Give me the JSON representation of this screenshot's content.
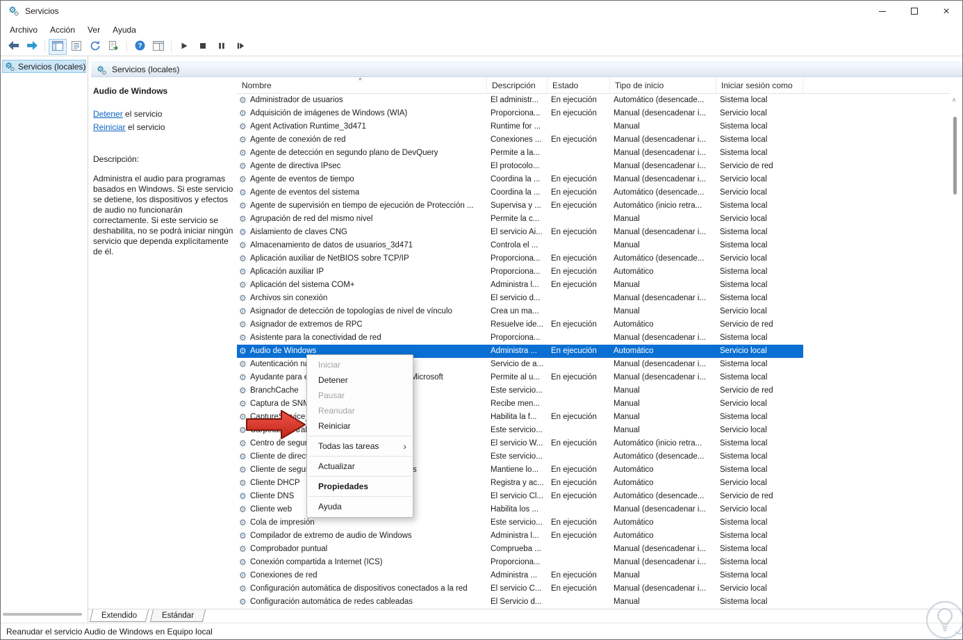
{
  "window": {
    "title": "Servicios"
  },
  "menubar": {
    "items": [
      "Archivo",
      "Acción",
      "Ver",
      "Ayuda"
    ]
  },
  "toolbar": {
    "groups": [
      [
        {
          "name": "back"
        },
        {
          "name": "forward"
        }
      ],
      [
        {
          "name": "show-console-tree",
          "pressed": true
        },
        {
          "name": "export-list"
        },
        {
          "name": "refresh"
        },
        {
          "name": "export"
        }
      ],
      [
        {
          "name": "help"
        },
        {
          "name": "window-pane"
        }
      ],
      [
        {
          "name": "start-service"
        },
        {
          "name": "stop-service"
        },
        {
          "name": "pause-service"
        },
        {
          "name": "restart-service"
        }
      ]
    ]
  },
  "tree": {
    "items": [
      {
        "label": "Servicios (locales)",
        "selected": true
      }
    ]
  },
  "main_header": {
    "title": "Servicios (locales)"
  },
  "info_pane": {
    "service_name": "Audio de Windows",
    "links": [
      {
        "action": "Detener",
        "suffix": " el servicio"
      },
      {
        "action": "Reiniciar",
        "suffix": " el servicio"
      }
    ],
    "description_label": "Descripción:",
    "description": "Administra el audio para programas basados en Windows. Si este servicio se detiene, los dispositivos y efectos de audio no funcionarán correctamente. Si este servicio se deshabilita, no se podrá iniciar ningún servicio que dependa explícitamente de él."
  },
  "table": {
    "columns": [
      "Nombre",
      "Descripción",
      "Estado",
      "Tipo de inicio",
      "Iniciar sesión como"
    ],
    "rows": [
      {
        "name": "Administrador de usuarios",
        "desc": "El administr...",
        "status": "En ejecución",
        "startup": "Automático (desencade...",
        "logon": "Sistema local"
      },
      {
        "name": "Adquisición de imágenes de Windows (WIA)",
        "desc": "Proporciona...",
        "status": "En ejecución",
        "startup": "Manual (desencadenar i...",
        "logon": "Servicio local"
      },
      {
        "name": "Agent Activation Runtime_3d471",
        "desc": "Runtime for ...",
        "status": "",
        "startup": "Manual",
        "logon": "Sistema local"
      },
      {
        "name": "Agente de conexión de red",
        "desc": "Conexiones ...",
        "status": "En ejecución",
        "startup": "Manual (desencadenar i...",
        "logon": "Sistema local"
      },
      {
        "name": "Agente de detección en segundo plano de DevQuery",
        "desc": "Permite a la...",
        "status": "",
        "startup": "Manual (desencadenar i...",
        "logon": "Sistema local"
      },
      {
        "name": "Agente de directiva IPsec",
        "desc": "El protocolo...",
        "status": "",
        "startup": "Manual (desencadenar i...",
        "logon": "Servicio de red"
      },
      {
        "name": "Agente de eventos de tiempo",
        "desc": "Coordina la ...",
        "status": "En ejecución",
        "startup": "Manual (desencadenar i...",
        "logon": "Servicio local"
      },
      {
        "name": "Agente de eventos del sistema",
        "desc": "Coordina la ...",
        "status": "En ejecución",
        "startup": "Automático (desencade...",
        "logon": "Servicio local"
      },
      {
        "name": "Agente de supervisión en tiempo de ejecución de Protección ...",
        "desc": "Supervisa y ...",
        "status": "En ejecución",
        "startup": "Automático (inicio retra...",
        "logon": "Sistema local"
      },
      {
        "name": "Agrupación de red del mismo nivel",
        "desc": "Permite la c...",
        "status": "",
        "startup": "Manual",
        "logon": "Servicio local"
      },
      {
        "name": "Aislamiento de claves CNG",
        "desc": "El servicio Ai...",
        "status": "En ejecución",
        "startup": "Manual (desencadenar i...",
        "logon": "Sistema local"
      },
      {
        "name": "Almacenamiento de datos de usuarios_3d471",
        "desc": "Controla el ...",
        "status": "",
        "startup": "Manual",
        "logon": "Sistema local"
      },
      {
        "name": "Aplicación auxiliar de NetBIOS sobre TCP/IP",
        "desc": "Proporciona...",
        "status": "En ejecución",
        "startup": "Automático (desencade...",
        "logon": "Servicio local"
      },
      {
        "name": "Aplicación auxiliar IP",
        "desc": "Proporciona...",
        "status": "En ejecución",
        "startup": "Automático",
        "logon": "Sistema local"
      },
      {
        "name": "Aplicación del sistema COM+",
        "desc": "Administra l...",
        "status": "En ejecución",
        "startup": "Manual",
        "logon": "Sistema local"
      },
      {
        "name": "Archivos sin conexión",
        "desc": "El servicio d...",
        "status": "",
        "startup": "Manual (desencadenar i...",
        "logon": "Sistema local"
      },
      {
        "name": "Asignador de detección de topologías de nivel de vínculo",
        "desc": "Crea un ma...",
        "status": "",
        "startup": "Manual",
        "logon": "Servicio local"
      },
      {
        "name": "Asignador de extremos de RPC",
        "desc": "Resuelve ide...",
        "status": "En ejecución",
        "startup": "Automático",
        "logon": "Servicio de red"
      },
      {
        "name": "Asistente para la conectividad de red",
        "desc": "Proporciona...",
        "status": "",
        "startup": "Manual (desencadenar i...",
        "logon": "Sistema local"
      },
      {
        "name": "Audio de Windows",
        "desc": "Administra ...",
        "status": "En ejecución",
        "startup": "Automático",
        "logon": "Servicio local",
        "selected": true
      },
      {
        "name": "Autenticación natural",
        "desc": "Servicio de a...",
        "status": "",
        "startup": "Manual (desencadenar i...",
        "logon": "Sistema local"
      },
      {
        "name": "Ayudante para el inicio de sesión de cuentas Microsoft",
        "desc": "Permite al u...",
        "status": "En ejecución",
        "startup": "Manual (desencadenar i...",
        "logon": "Sistema local"
      },
      {
        "name": "BranchCache",
        "desc": "Este servicio...",
        "status": "",
        "startup": "Manual",
        "logon": "Servicio de red"
      },
      {
        "name": "Captura de SNMP",
        "desc": "Recibe men...",
        "status": "",
        "startup": "Manual",
        "logon": "Servicio local"
      },
      {
        "name": "CaptureService_3d471",
        "desc": "Habilita la f...",
        "status": "En ejecución",
        "startup": "Manual",
        "logon": "Sistema local"
      },
      {
        "name": "Carpetas de trabajo",
        "desc": "Este servicio...",
        "status": "",
        "startup": "Manual",
        "logon": "Servicio local"
      },
      {
        "name": "Centro de seguridad",
        "desc": "El servicio W...",
        "status": "En ejecución",
        "startup": "Automático (inicio retra...",
        "logon": "Sistema local"
      },
      {
        "name": "Cliente de directiva de grupo",
        "desc": "Este servicio...",
        "status": "",
        "startup": "Automático (desencade...",
        "logon": "Sistema local"
      },
      {
        "name": "Cliente de seguimiento de vínculos distribuidos",
        "desc": "Mantiene lo...",
        "status": "En ejecución",
        "startup": "Automático",
        "logon": "Sistema local"
      },
      {
        "name": "Cliente DHCP",
        "desc": "Registra y ac...",
        "status": "En ejecución",
        "startup": "Automático",
        "logon": "Servicio local"
      },
      {
        "name": "Cliente DNS",
        "desc": "El servicio Cl...",
        "status": "En ejecución",
        "startup": "Automático (desencade...",
        "logon": "Servicio de red"
      },
      {
        "name": "Cliente web",
        "desc": "Habilita los ...",
        "status": "",
        "startup": "Manual (desencadenar i...",
        "logon": "Servicio local"
      },
      {
        "name": "Cola de impresión",
        "desc": "Este servicio...",
        "status": "En ejecución",
        "startup": "Automático",
        "logon": "Sistema local"
      },
      {
        "name": "Compilador de extremo de audio de Windows",
        "desc": "Administra l...",
        "status": "En ejecución",
        "startup": "Automático",
        "logon": "Sistema local"
      },
      {
        "name": "Comprobador puntual",
        "desc": "Comprueba ...",
        "status": "",
        "startup": "Manual (desencadenar i...",
        "logon": "Sistema local"
      },
      {
        "name": "Conexión compartida a Internet (ICS)",
        "desc": "Proporciona...",
        "status": "",
        "startup": "Manual (desencadenar i...",
        "logon": "Sistema local"
      },
      {
        "name": "Conexiones de red",
        "desc": "Administra ...",
        "status": "En ejecución",
        "startup": "Manual",
        "logon": "Sistema local"
      },
      {
        "name": "Configuración automática de dispositivos conectados a la red",
        "desc": "El servicio C...",
        "status": "En ejecución",
        "startup": "Manual (desencadenar i...",
        "logon": "Servicio local"
      },
      {
        "name": "Configuración automática de redes cableadas",
        "desc": "El Servicio d...",
        "status": "",
        "startup": "Manual",
        "logon": "Sistema local"
      }
    ]
  },
  "context_menu": {
    "items": [
      {
        "label": "Iniciar",
        "disabled": true
      },
      {
        "label": "Detener"
      },
      {
        "label": "Pausar",
        "disabled": true
      },
      {
        "label": "Reanudar",
        "disabled": true
      },
      {
        "label": "Reiniciar"
      },
      {
        "type": "separator"
      },
      {
        "label": "Todas las tareas",
        "submenu": true
      },
      {
        "type": "separator"
      },
      {
        "label": "Actualizar"
      },
      {
        "type": "separator"
      },
      {
        "label": "Propiedades",
        "bold": true
      },
      {
        "type": "separator"
      },
      {
        "label": "Ayuda"
      }
    ]
  },
  "tabs": {
    "items": [
      {
        "label": "Extendido",
        "active": true
      },
      {
        "label": "Estándar",
        "active": false
      }
    ]
  },
  "status_bar": {
    "text": "Reanudar el servicio Audio de Windows en Equipo local"
  },
  "colors": {
    "selection": "#0a6fd2",
    "link": "#0b63c5",
    "arrow": "#d8382a",
    "arrow_outline": "#7e150d"
  }
}
